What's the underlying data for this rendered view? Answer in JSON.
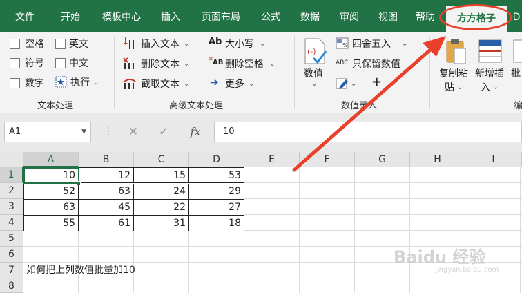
{
  "tabs": [
    {
      "label": "文件",
      "active": false
    },
    {
      "label": "开始",
      "active": false
    },
    {
      "label": "模板中心",
      "active": false
    },
    {
      "label": "插入",
      "active": false
    },
    {
      "label": "页面布局",
      "active": false
    },
    {
      "label": "公式",
      "active": false
    },
    {
      "label": "数据",
      "active": false
    },
    {
      "label": "审阅",
      "active": false
    },
    {
      "label": "视图",
      "active": false
    },
    {
      "label": "帮助",
      "active": false
    },
    {
      "label": "方方格子",
      "active": true
    },
    {
      "label": "D",
      "active": false
    }
  ],
  "ribbon": {
    "text_group": {
      "label": "文本处理",
      "checkboxes": [
        "空格",
        "英文",
        "符号",
        "中文",
        "数字"
      ],
      "execute": "执行"
    },
    "advanced_group": {
      "label": "高级文本处理",
      "insert_text": "插入文本",
      "delete_text": "删除文本",
      "extract_text": "截取文本",
      "case": "大小写",
      "delete_spaces": "删除空格",
      "more": "更多",
      "case_icon": "Ab",
      "delete_spaces_icon": "AB"
    },
    "number_group": {
      "label": "数值录入",
      "value": "数值",
      "round": "四舍五入",
      "keep_values": "只保留数值",
      "keep_values_icon": "ABC",
      "plus": "+"
    },
    "copy_paste": {
      "line1": "复制粘",
      "line2": "贴"
    },
    "new_insert": {
      "line1": "新增插",
      "line2": "入"
    },
    "batch": {
      "line1": "批"
    },
    "edit_group_label": "编"
  },
  "formula_bar": {
    "name_box": "A1",
    "cancel": "✕",
    "confirm": "✓",
    "fx": "fx",
    "value": "10"
  },
  "sheet": {
    "columns": [
      "A",
      "B",
      "C",
      "D",
      "E",
      "F",
      "G",
      "H",
      "I"
    ],
    "rows": [
      "1",
      "2",
      "3",
      "4",
      "5",
      "6",
      "7",
      "8"
    ],
    "table": [
      [
        "10",
        "12",
        "15",
        "53"
      ],
      [
        "52",
        "63",
        "24",
        "29"
      ],
      [
        "63",
        "45",
        "22",
        "27"
      ],
      [
        "55",
        "61",
        "31",
        "18"
      ]
    ],
    "note": "如何把上列数值批量加10",
    "active_cell": "A1"
  },
  "watermark": {
    "main": "Baidu 经验",
    "sub": "jingyan.baidu.com"
  },
  "colors": {
    "excel_green": "#217346",
    "annotation_red": "#e8402a"
  }
}
